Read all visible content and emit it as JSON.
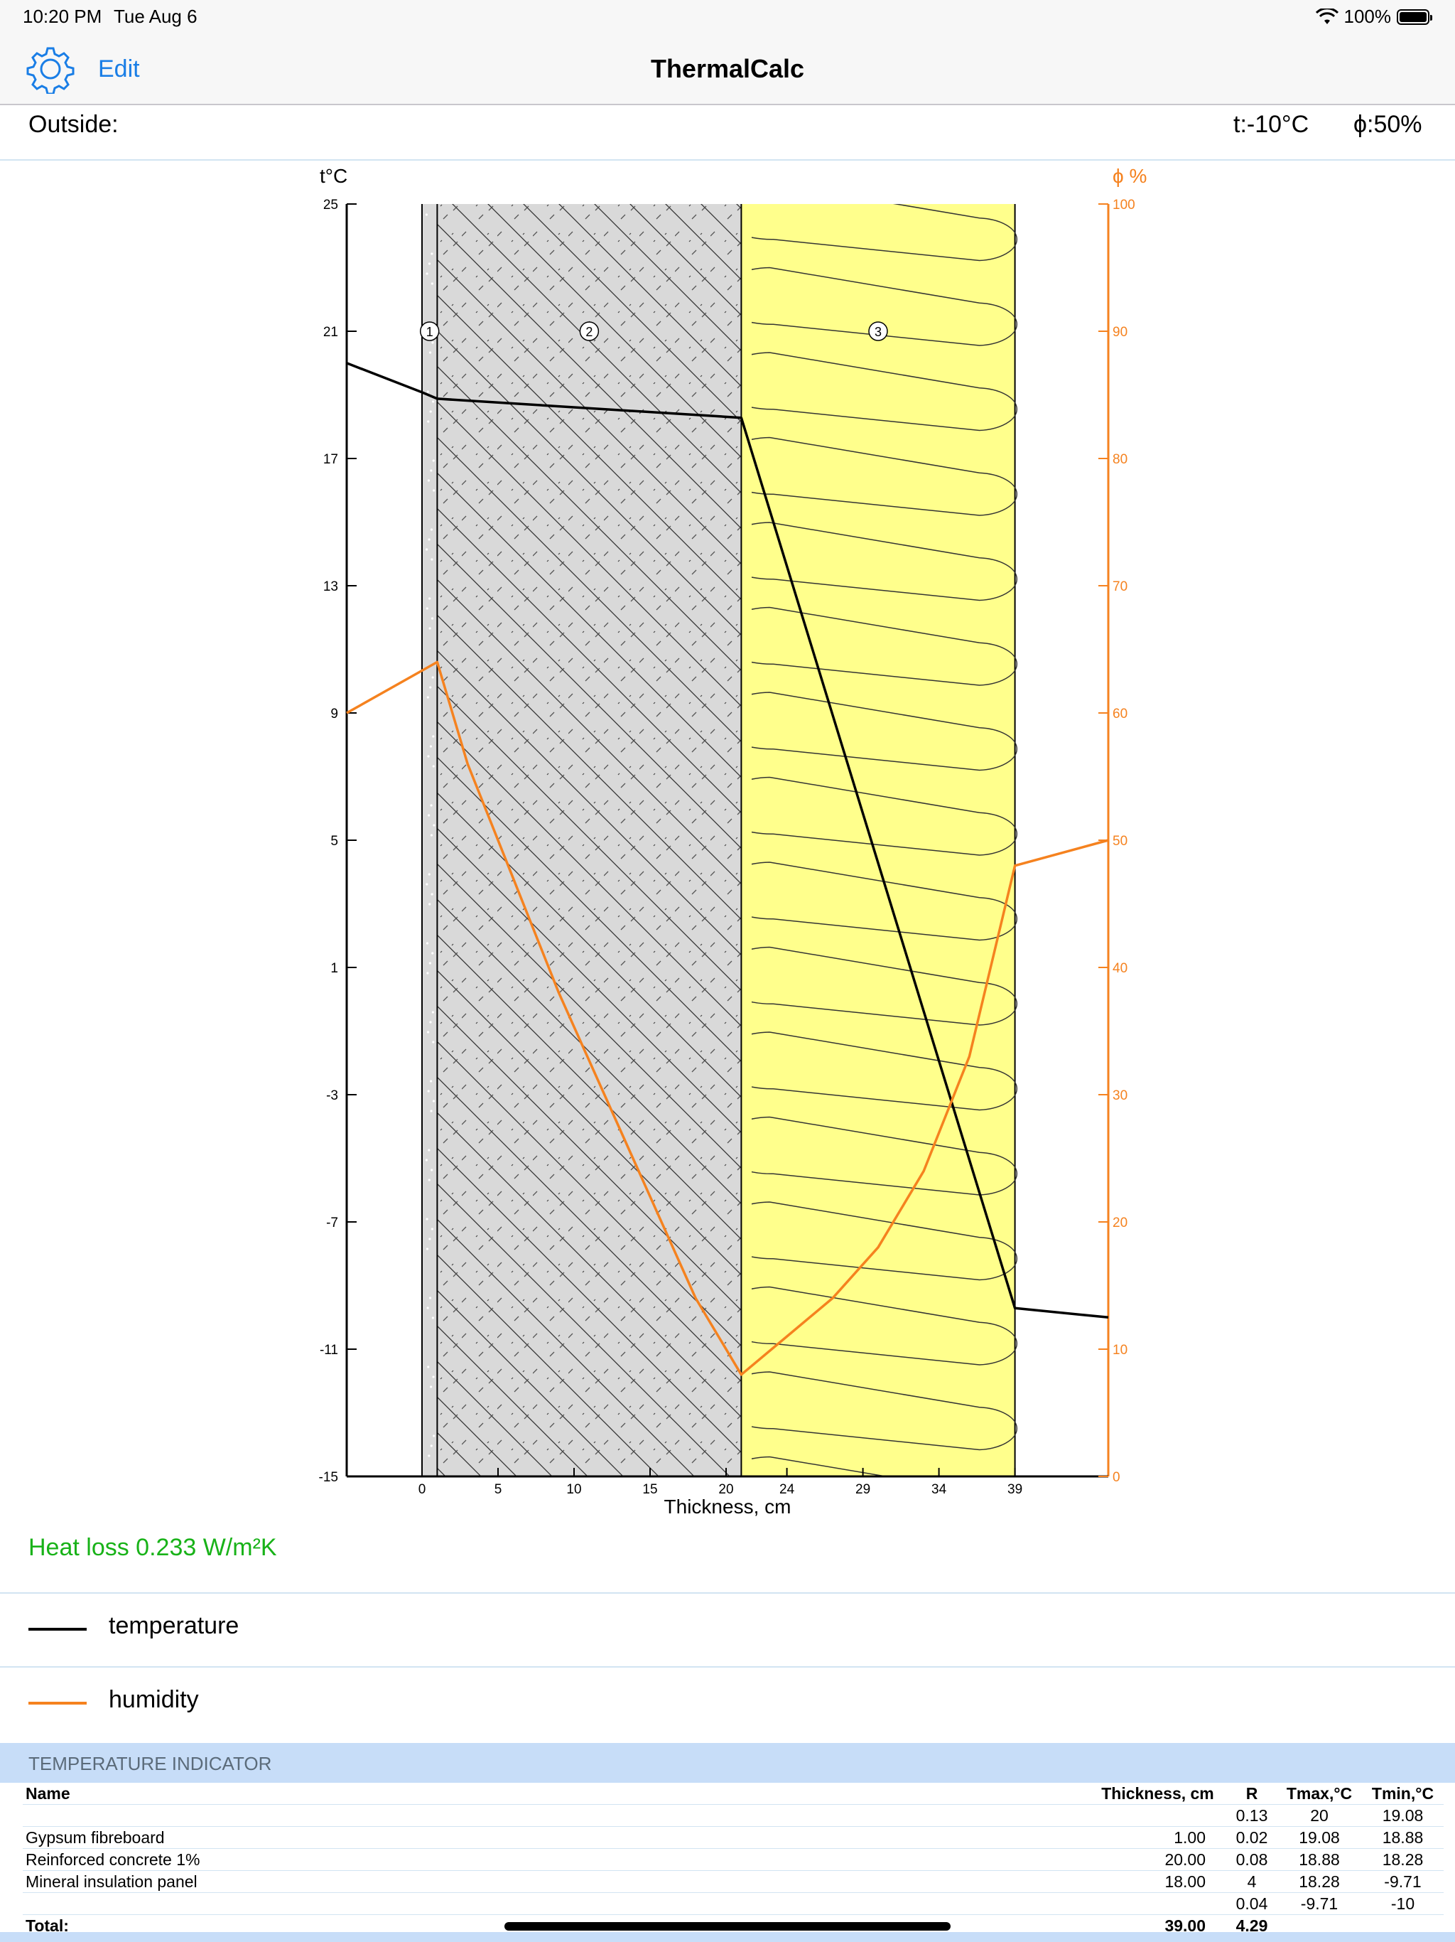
{
  "status": {
    "time": "10:20 PM",
    "date": "Tue Aug 6",
    "battery": "100%"
  },
  "nav": {
    "edit_label": "Edit",
    "title": "ThermalCalc"
  },
  "outside": {
    "label": "Outside:",
    "temp": "t:-10°C",
    "humidity": "ϕ:50%"
  },
  "colors": {
    "temperature": "#000000",
    "humidity": "#f5821f",
    "heatloss": "#18b218",
    "accent": "#1a7ee6",
    "insulation": "#ffff8c",
    "concrete": "#d9d9d9"
  },
  "chart_data": {
    "type": "line",
    "xlabel": "Thickness, cm",
    "ylabel_left": "t°C",
    "ylabel_right": "ϕ %",
    "x_ticks": [
      "0",
      "5",
      "10",
      "15",
      "20",
      "24",
      "29",
      "34",
      "39"
    ],
    "y_left_ticks": [
      25,
      21,
      17,
      13,
      9,
      5,
      1,
      -3,
      -7,
      -11,
      -15
    ],
    "y_right_ticks": [
      100,
      90,
      80,
      70,
      60,
      50,
      40,
      30,
      20,
      10,
      0
    ],
    "ylim_left": [
      -15,
      25
    ],
    "ylim_right": [
      0,
      100
    ],
    "layers": [
      {
        "id": "1",
        "name": "Gypsum fibreboard",
        "from": 0,
        "to": 1
      },
      {
        "id": "2",
        "name": "Reinforced concrete 1%",
        "from": 1,
        "to": 21
      },
      {
        "id": "3",
        "name": "Mineral insulation panel",
        "from": 21,
        "to": 39
      }
    ],
    "series": [
      {
        "name": "temperature",
        "axis": "left",
        "x": [
          -5,
          0,
          1,
          21,
          39,
          44
        ],
        "y": [
          20,
          19.08,
          18.88,
          18.28,
          -9.71,
          -10
        ]
      },
      {
        "name": "humidity",
        "axis": "right",
        "x": [
          -5,
          1,
          3,
          6,
          9,
          12,
          15,
          18,
          21,
          24,
          27,
          30,
          33,
          36,
          39,
          44
        ],
        "y": [
          60,
          64,
          56,
          47,
          38,
          30,
          22,
          14,
          8,
          11,
          14,
          18,
          24,
          33,
          48,
          50
        ]
      }
    ]
  },
  "heat_loss": "Heat loss 0.233 W/m²K",
  "legend": {
    "temperature": "temperature",
    "humidity": "humidity"
  },
  "section_title": "TEMPERATURE INDICATOR",
  "table": {
    "headers": [
      "Name",
      "Thickness, cm",
      "R",
      "Tmax,°C",
      "Tmin,°C"
    ],
    "rows": [
      [
        "",
        "",
        "0.13",
        "20",
        "19.08"
      ],
      [
        "Gypsum fibreboard",
        "1.00",
        "0.02",
        "19.08",
        "18.88"
      ],
      [
        "Reinforced concrete 1%",
        "20.00",
        "0.08",
        "18.88",
        "18.28"
      ],
      [
        "Mineral insulation panel",
        "18.00",
        "4",
        "18.28",
        "-9.71"
      ],
      [
        "",
        "",
        "0.04",
        "-9.71",
        "-10"
      ]
    ],
    "total": [
      "Total:",
      "39.00",
      "4.29",
      "",
      ""
    ]
  }
}
